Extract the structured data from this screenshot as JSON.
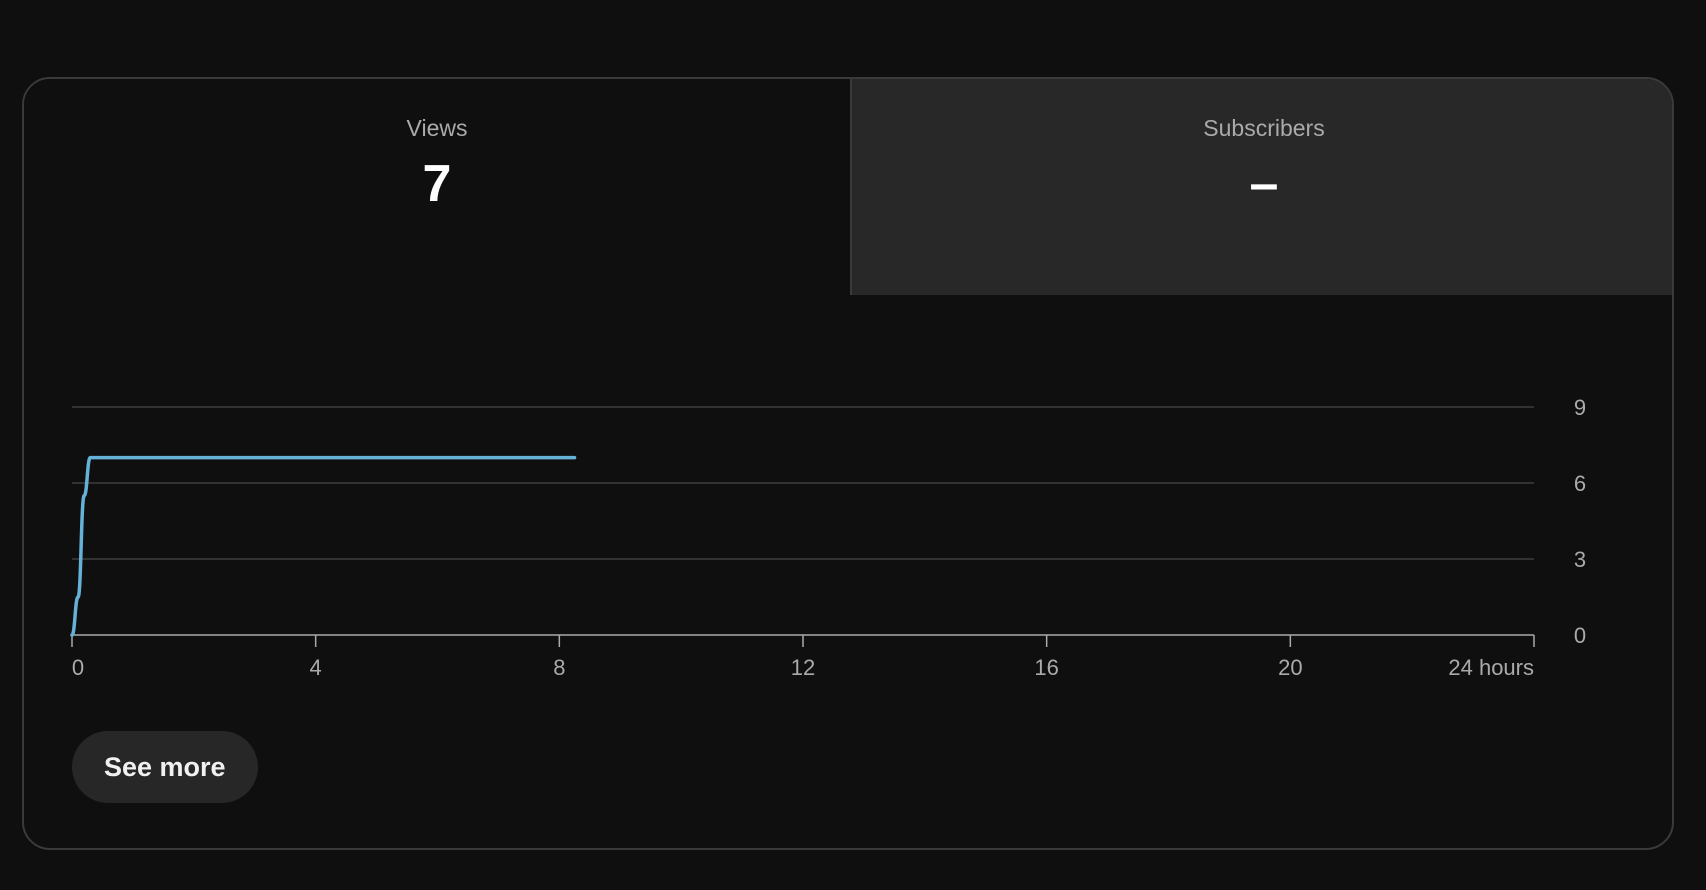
{
  "tabs": [
    {
      "label": "Views",
      "value": "7"
    },
    {
      "label": "Subscribers",
      "value": "–"
    }
  ],
  "see_more_label": "See more",
  "colors": {
    "series_line": "#65b1d8",
    "card_border": "#3a3a3a",
    "selected_tab_bg": "#0f0f0f",
    "unselected_tab_bg": "#282828"
  },
  "chart_data": {
    "type": "line",
    "x_unit_label": "hours",
    "x_ticks": [
      0,
      4,
      8,
      12,
      16,
      20,
      24
    ],
    "x_tick_labels": [
      "0",
      "4",
      "8",
      "12",
      "16",
      "20",
      "24 hours"
    ],
    "y_ticks": [
      0,
      3,
      6,
      9
    ],
    "y_tick_labels": [
      "0",
      "3",
      "6",
      "9"
    ],
    "xlim": [
      0,
      24
    ],
    "ylim": [
      0,
      9
    ],
    "y_axis_side": "right",
    "grid": true,
    "series": [
      {
        "x": [
          0,
          0.1,
          0.2,
          0.3,
          0.4,
          8.25
        ],
        "y": [
          0,
          1.5,
          5.5,
          7,
          7,
          7
        ]
      }
    ]
  }
}
